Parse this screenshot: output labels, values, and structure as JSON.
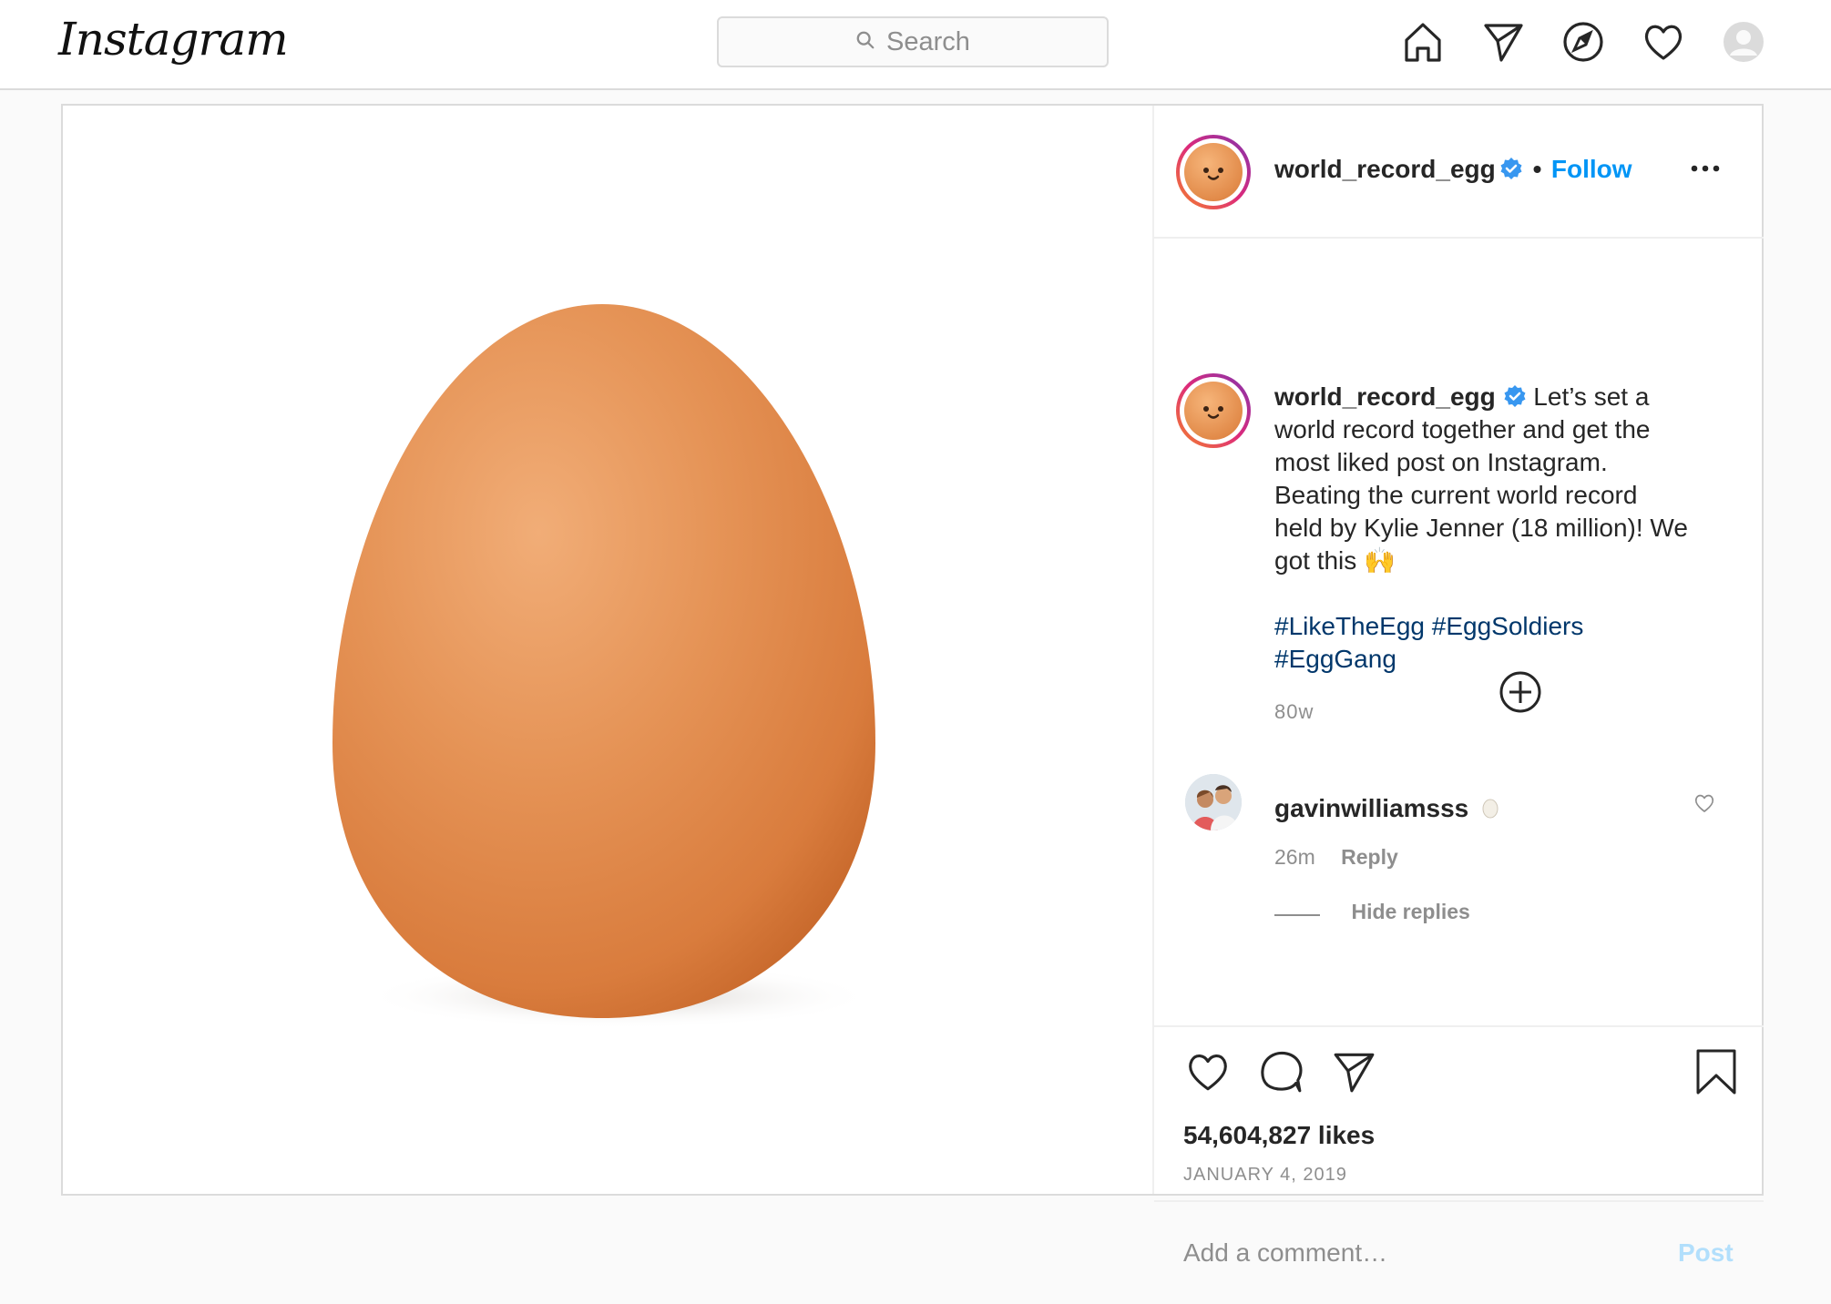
{
  "topbar": {
    "logo_text": "Instagram",
    "search_placeholder": "Search",
    "icons": [
      "home-icon",
      "direct-icon",
      "explore-icon",
      "activity-heart-icon",
      "profile-avatar"
    ]
  },
  "post": {
    "author": "world_record_egg",
    "follow_label": "Follow",
    "more_icon": "more-options-icon",
    "caption": {
      "username": "world_record_egg",
      "lines": [
        "Let’s set a",
        "world record together and get the",
        "most liked post on Instagram.",
        "Beating the current world record",
        "held by Kylie Jenner (18 million)! We",
        "got this 🙌"
      ],
      "hashtags_line1": "#LikeTheEgg #EggSoldiers",
      "hashtags_line2": "#EggGang",
      "time_ago": "80w"
    },
    "comment": {
      "username": "gavinwilliamsss",
      "time": "26m",
      "reply_label": "Reply",
      "hide_replies_label": "Hide replies"
    },
    "likes": "54,604,827 likes",
    "date": "January 4, 2019",
    "comment_placeholder": "Add a comment…",
    "post_label": "Post"
  },
  "colors": {
    "accent_blue": "#0095f6",
    "hashtag_blue": "#00376b",
    "muted": "#8e8e8e",
    "border": "#dbdbdb"
  }
}
